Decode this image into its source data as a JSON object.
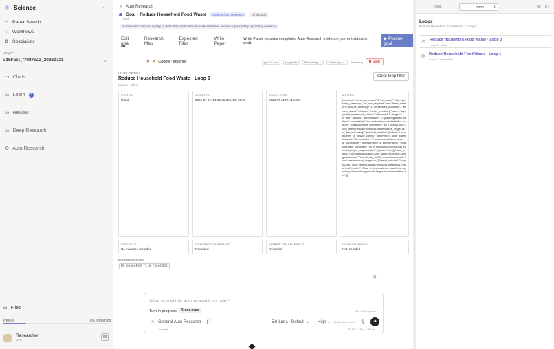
{
  "sidebar": {
    "brand": "Science",
    "nav": [
      {
        "icon": "search-icon",
        "glyph": "⌕",
        "label": "Paper Search"
      },
      {
        "icon": "workflow-icon",
        "glyph": "◌",
        "label": "Workflows"
      },
      {
        "icon": "specialists-icon",
        "glyph": "⚙",
        "label": "Specialists"
      }
    ],
    "project_label": "Project",
    "project_name": "V15Fast_f7987ea2_20260721",
    "chats": "Chats",
    "learn": "Learn",
    "learn_badge": "1",
    "review": "Review",
    "deep_research": "Deep Research",
    "auto_research": "Auto Research",
    "files": "Files",
    "weekly_label": "Weekly",
    "weekly_remaining": "78% remaining",
    "weekly_used_fraction": 0.22,
    "user_name": "Researcher",
    "user_plan": "Pro"
  },
  "main": {
    "breadcrumb": "Auto Research",
    "goal_title": "Goal · Reduce Household Food Waste",
    "goal_tag": "General Auto Research",
    "goal_loops": "0 / 8 loops",
    "goal_status": "draft",
    "goal_desc": "Number and practical quality of distinct household food-waste reduction actions supported by repository evidence",
    "actions": [
      "Edit goal",
      "Research Map",
      "Expected Files",
      "Write Paper"
    ],
    "actions_note": "Write Paper requires completed Auto Research evidence; current status is draft.",
    "pursue_label": "Pursue goal",
    "more": "•••",
    "run_codes": "Codes · steered",
    "run_model": "gpt-5.6-luna",
    "run_style": "pragmatic",
    "run_reasoning": "Reasoning: ...",
    "run_summary": "Summary: a...",
    "run_streaming": "Streaming",
    "stop_label": "Stop",
    "loop_kicker": "LOOP DETAIL",
    "loop_title": "Reduce Household Food Waste · Loop 0",
    "loop_sub": "Loop 1 · failed",
    "clear_filter": "Clear loop filter",
    "cards": {
      "status_label": "STATUS",
      "status_value": "failed",
      "created_label": "CREATED",
      "created_value": "2026-07-21T21:39:41.322498+00:00",
      "completed_label": "COMPLETED",
      "completed_value": "2026-07-21T21:46:37Z",
      "metric_label": "METRIC",
      "metric_value": "{\"metrics\":{\"schema_version\":1,\"run_scale\":\"full_repository_inventory\",\"full_run_required\":true,\"direct_metric\":0,\"source_coverage\":1,\"unresolved_blockers\":1,\"review_status\":\"blocked\",\"direct_metrics\":[{\"name\":\"supported_household_actions\",\"observed\":0,\"target\":10,\"unit\":\"actions\",\"denominator\":\"0 qualifying evidence items\",\"uncertainty\":\"not estimable; no substantive sources\",\"measurement_command\":\"wc -l loops/Loop_0000_reduce-household-food-waste/source_ledger.csv\",\"passed\":false}],\"guardrail_metrics\":[{\"name\":\"unsupported_or_unsafe_claims\",\"observed\":0,\"unit\":\"claims issued\",\"denominator\":\"0 recommendations issued\",\"uncertainty\":\"not estimable for interventions\",\"measurement_command\":\"rg -n 'food|waste|household' inventory/repo_snapshot.json\",\"passed\":true}],\"data_inputs\":[\"contracts/snapshot.json\",\"setup/accepted-configuration.json\",\"loops/Loop_0000_reduce-household-food-waste/source_ledger.csv\"],\"result_outputs\":[\"loops/Loop_0000_reduce-household-food-waste/final_report.md\"],\"notes\":\"Clear limited-evidence result: the repository does not support the target recommendation set.\"}}",
      "evidence_label": "EVIDENCE",
      "evidence_value": "No evidence recorded",
      "contract_label": "CONTRACT SNAPSHOT",
      "contract_value": "Recorded",
      "workflow_label": "WORKFLOW SNAPSHOT",
      "workflow_value": "Recorded",
      "code_label": "CODE SNAPSHOT",
      "code_value": "Not recorded"
    },
    "expected_label": "EXPECTED FILES",
    "expected_chip": "No expected file recorded",
    "composer_placeholder": "What should this auto research do next?",
    "turn_progress": "Turn in progress",
    "steer_now": "Steer now",
    "composer_hint": "Ctrl+Enter queues",
    "mode": "General Auto Research",
    "mode_paren": "( )",
    "model": "5.6-Luna · Default",
    "effort": "High",
    "tokens": "1 total agent docs",
    "context_label": "Context",
    "context_value": "83.5% · 2.5 rk · 300 rk",
    "context_fraction": 0.83
  },
  "right": {
    "tab_tools": "Tools",
    "tab_loops": "Loops",
    "loops_title": "Loops",
    "loops_sub": "Reduce Household Food Waste · 2 loops",
    "loops": [
      {
        "name": "Reduce Household Food Waste · Loop 0",
        "meta": "Loop 1 · failed"
      },
      {
        "name": "Reduce Household Food Waste · Loop 1",
        "meta": "Loop 2 · incomplete"
      }
    ]
  },
  "colors": {
    "accent": "#6a7ec7",
    "brand": "#6b5fd3",
    "danger": "#c83a3a"
  }
}
